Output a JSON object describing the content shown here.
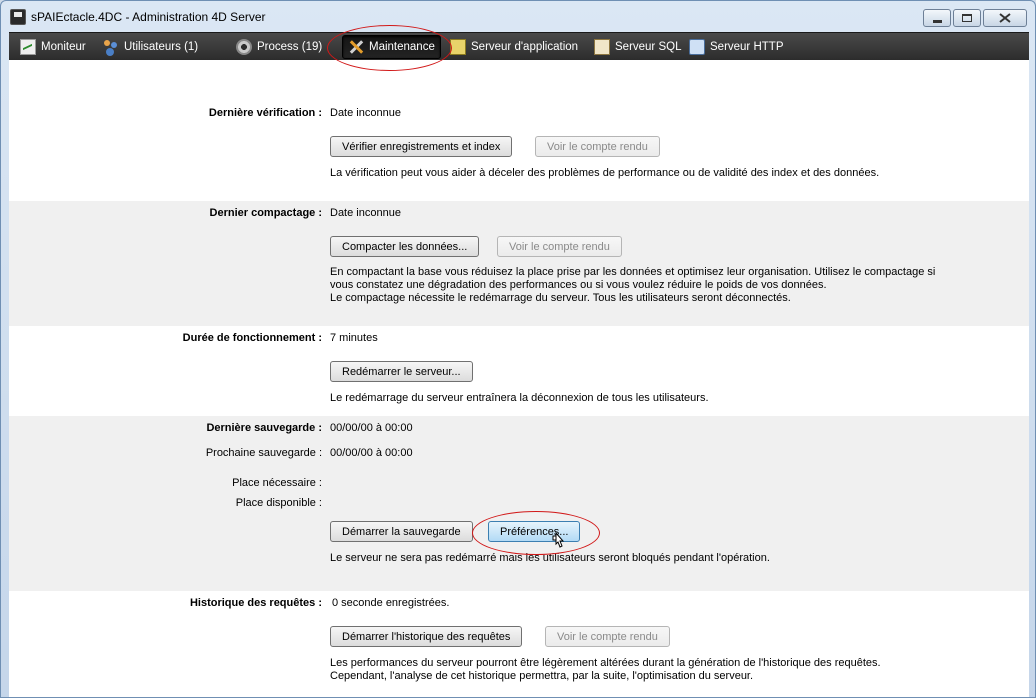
{
  "window": {
    "title": "sPAIEctacle.4DC - Administration 4D Server",
    "controls": [
      "minimize",
      "maximize",
      "close"
    ]
  },
  "toolbar": {
    "tabs": [
      {
        "label": "Moniteur",
        "icon": "monitor-icon"
      },
      {
        "label": "Utilisateurs (1)",
        "icon": "users-icon"
      },
      {
        "label": "Process (19)",
        "icon": "gear-icon"
      },
      {
        "label": "Maintenance",
        "icon": "tools-icon",
        "active": true
      },
      {
        "label": "Serveur d'application",
        "icon": "app-server-icon"
      },
      {
        "label": "Serveur SQL",
        "icon": "sql-server-icon"
      },
      {
        "label": "Serveur HTTP",
        "icon": "http-server-icon"
      }
    ]
  },
  "verification": {
    "label": "Dernière vérification :",
    "value": "Date inconnue",
    "verify_button": "Vérifier enregistrements et index",
    "report_button": "Voir le compte rendu",
    "description": "La vérification peut vous aider à déceler des problèmes de performance ou de validité des index et des données."
  },
  "compaction": {
    "label": "Dernier compactage :",
    "value": "Date inconnue",
    "compact_button": "Compacter les données...",
    "report_button": "Voir le compte rendu",
    "description_lines": [
      "En compactant la base vous réduisez la place prise par les données et optimisez leur organisation. Utilisez le compactage si",
      "vous constatez une dégradation des performances ou si vous voulez réduire le poids de vos données.",
      "Le compactage nécessite le redémarrage du serveur. Tous les utilisateurs seront déconnectés."
    ]
  },
  "uptime": {
    "label": "Durée de fonctionnement :",
    "value": "7 minutes",
    "restart_button": "Redémarrer le serveur...",
    "description": "Le redémarrage du serveur entraînera la déconnexion de tous les utilisateurs."
  },
  "backup": {
    "last_label": "Dernière sauvegarde :",
    "last_value": "00/00/00 à 00:00",
    "next_label": "Prochaine sauvegarde :",
    "next_value": "00/00/00 à 00:00",
    "space_needed_label": "Place nécessaire :",
    "space_available_label": "Place disponible :",
    "start_button": "Démarrer la sauvegarde",
    "preferences_button": "Préférences...",
    "description": "Le serveur ne sera pas redémarré mais les utilisateurs seront bloqués pendant l'opération."
  },
  "request_log": {
    "label": "Historique des requêtes :",
    "value": "0 seconde enregistrées.",
    "start_button": "Démarrer l'historique des requêtes",
    "report_button": "Voir le compte rendu",
    "description_lines": [
      "Les performances du serveur pourront être légèrement altérées durant la génération de l'historique des requêtes.",
      "Cependant, l'analyse de cet historique permettra, par la suite, l'optimisation du serveur."
    ]
  },
  "colors": {
    "highlight_ring": "#d11818",
    "toolbar_bg": "#3a3a3a",
    "section_gray": "#f0f0f0"
  }
}
